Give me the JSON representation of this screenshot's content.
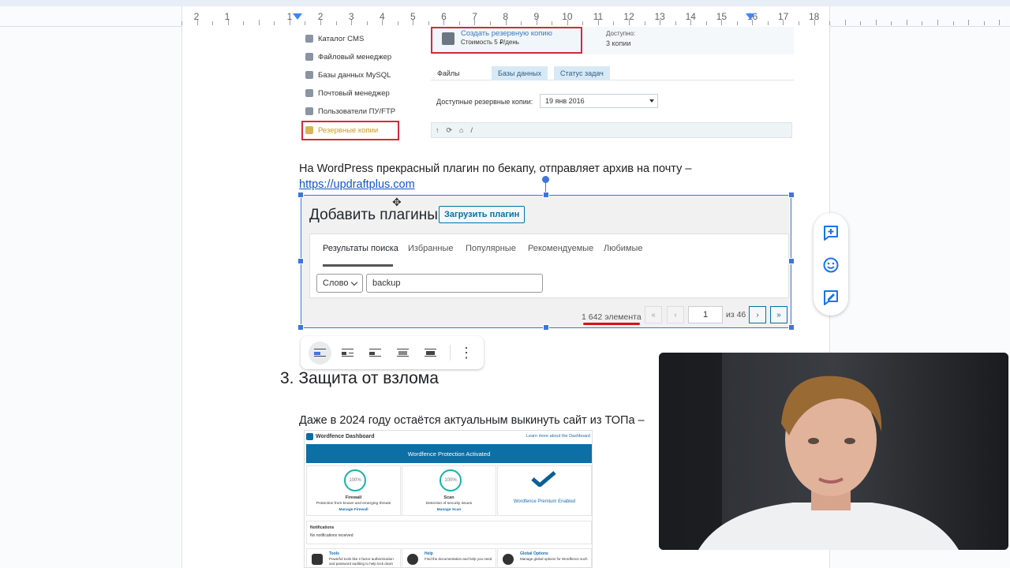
{
  "ruler": {
    "labels": [
      "2",
      "1",
      "1",
      "2",
      "3",
      "4",
      "5",
      "6",
      "7",
      "8",
      "9",
      "10",
      "11",
      "12",
      "13",
      "14",
      "15",
      "16",
      "17",
      "18"
    ]
  },
  "backup_screenshot": {
    "sidebar": [
      {
        "label": "Каталог CMS",
        "icon": "catalog-icon"
      },
      {
        "label": "Файловый менеджер",
        "icon": "folder-icon"
      },
      {
        "label": "Базы данных MySQL",
        "icon": "database-icon"
      },
      {
        "label": "Почтовый менеджер",
        "icon": "mail-icon"
      },
      {
        "label": "Пользователи ПУ/FTP",
        "icon": "users-icon"
      },
      {
        "label": "Резервные копии",
        "icon": "backup-icon"
      }
    ],
    "create_title": "Создать резервную копию",
    "create_cost": "Стоимость 5 ₽/день",
    "available_label": "Доступно:",
    "available_value": "3 копии",
    "tabs": [
      "Файлы",
      "Базы данных",
      "Статус задач"
    ],
    "field_label": "Доступные резервные копии:",
    "field_value": "19 янв 2016",
    "path": "/"
  },
  "paragraph1": {
    "text": "На WordPress прекрасный плагин по бекапу, отправляет архив на почту –",
    "link": "https://updraftplus.com"
  },
  "plugins_screenshot": {
    "title": "Добавить плагины",
    "upload_button": "Загрузить плагин",
    "tabs": [
      "Результаты поиска",
      "Избранные",
      "Популярные",
      "Рекомендуемые",
      "Любимые"
    ],
    "filter_value": "Слово",
    "search_value": "backup",
    "count": "1 642 элемента",
    "page_first": "«",
    "page_prev": "‹",
    "page_current": "1",
    "page_of": "из 46",
    "page_next": "›",
    "page_last": "»"
  },
  "heading": "3. Защита от взлома",
  "paragraph2": "Даже в 2024 году остаётся актуальным выкинуть сайт из ТОПа –",
  "wordfence": {
    "title": "Wordfence Dashboard",
    "link": "Learn more about the Dashboard",
    "banner": "Wordfence Protection Activated",
    "cards": [
      {
        "percent": "100%",
        "name": "Firewall",
        "desc": "Protection from known and emerging threats",
        "manage": "Manage Firewall"
      },
      {
        "percent": "100%",
        "name": "Scan",
        "desc": "Detection of security issues",
        "manage": "Manage Scan"
      }
    ],
    "premium": "Wordfence Premium Enabled",
    "notifications_title": "Notifications",
    "notifications_empty": "No notifications received",
    "bottom": [
      {
        "title": "Tools",
        "desc": "Powerful tools like 2 factor authentication and password auditing to help lock down"
      },
      {
        "title": "Help",
        "desc": "Find the documentation and help you need"
      },
      {
        "title": "Global Options",
        "desc": "Manage global options for Wordfence such"
      }
    ]
  },
  "colors": {
    "accent": "#3d74e0",
    "highlight_red": "#d42a3a",
    "wp_blue": "#0073aa",
    "wordfence_blue": "#0c6fa5"
  }
}
